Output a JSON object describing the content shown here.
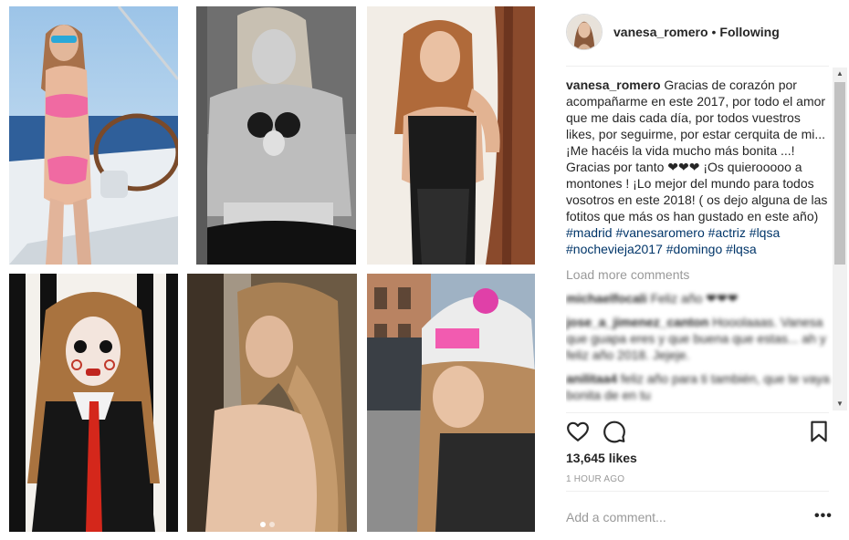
{
  "post": {
    "username": "vanesa_romero",
    "separator": "•",
    "follow_status": "Following",
    "caption_user": "vanesa_romero",
    "caption_text": "Gracias de corazón por acompañarme en este 2017, por todo el amor que me dais cada día, por todos vuestros likes, por seguirme, por estar cerquita de mi... ¡Me hacéis la vida mucho más bonita ...! Gracias por tanto ❤❤❤ ¡Os quierooooo a montones ! ¡Lo mejor del mundo para todos vosotros en este 2018! ( os dejo alguna de las fotitos que más os han gustado en este año)",
    "hashtags": [
      "#madrid",
      "#vanesaromero",
      "#actriz",
      "#lqsa",
      "#nochevieja2017",
      "#domingo",
      "#lqsa"
    ],
    "load_more": "Load more comments",
    "comments": [
      {
        "user": "michaelfocali",
        "text": "Feliz año ❤❤❤"
      },
      {
        "user": "jose_a_jimenez_canton",
        "text": "Hooolaaas. Vanesa que guapa eres y que buena que estas... ah y feliz año 2018. Jejeje."
      },
      {
        "user": "anilitaa4",
        "text": "feliz año para ti también, que te vaya bonita de en tu"
      }
    ],
    "likes": "13,645 likes",
    "time": "1 HOUR AGO",
    "comment_placeholder": "Add a comment...",
    "more_options": "•••"
  },
  "icons": {
    "like": "heart-outline-icon",
    "comment": "speech-bubble-icon",
    "save": "bookmark-icon",
    "more": "ellipsis-icon"
  },
  "colors": {
    "link": "#003569",
    "muted": "#999999",
    "text": "#262626"
  },
  "carousel": {
    "count": 2,
    "active": 1
  }
}
